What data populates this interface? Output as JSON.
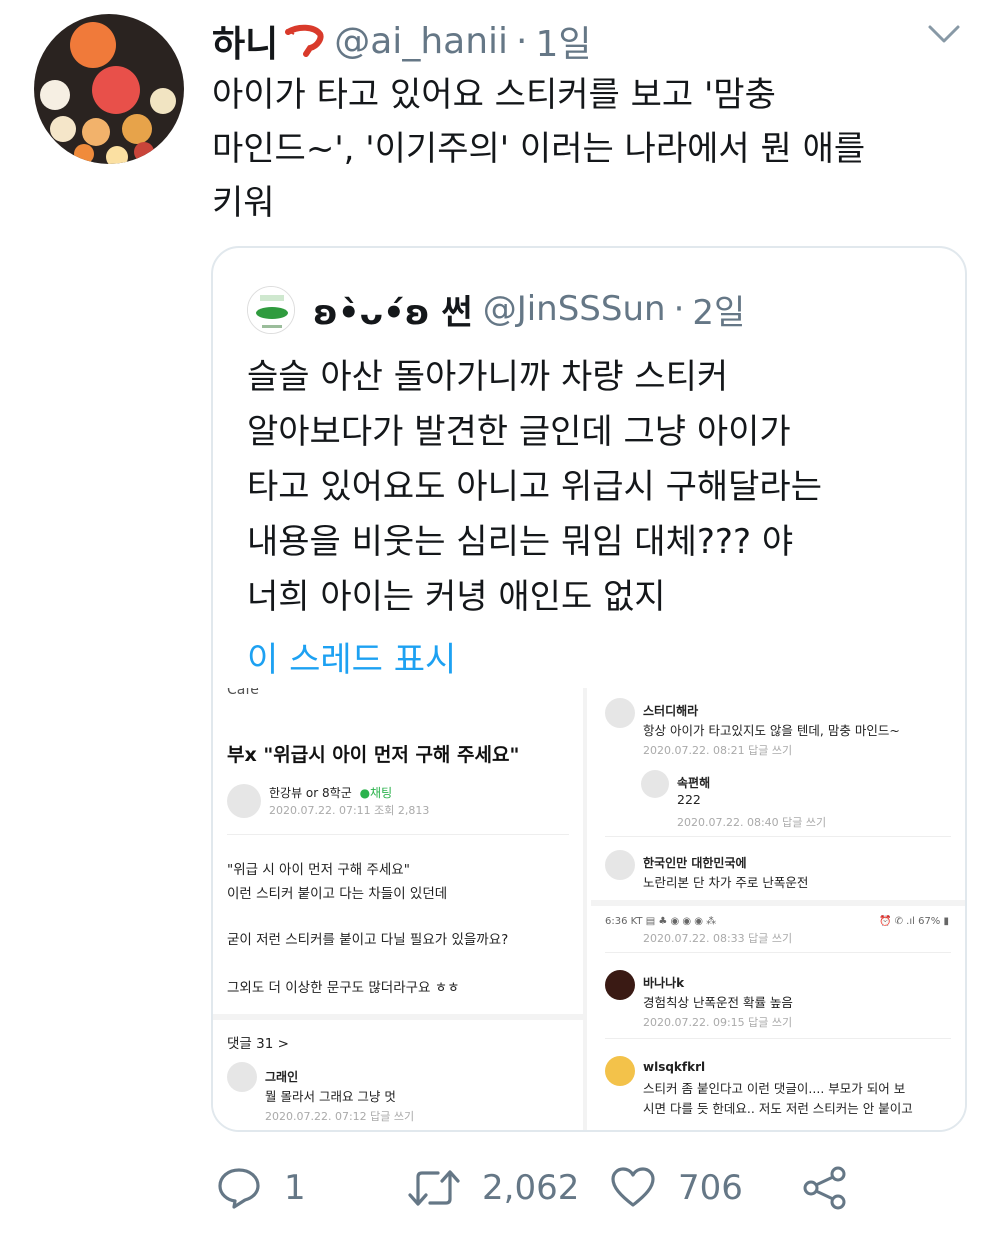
{
  "tweet": {
    "author_name": "하니",
    "author_handle": "@ai_hanii",
    "time_sep": "·",
    "time": "1일",
    "text_lines": [
      "아이가 타고 있어요 스티커를 보고 '맘충",
      "마인드~', '이기주의' 이러는 나라에서 뭔 애를",
      "키워"
    ]
  },
  "quote": {
    "author_name": "ʚ•̀ᴗ•́ʚ 썬",
    "author_handle": "@JinSSSun",
    "time_sep": "·",
    "time": "2일",
    "text_lines": [
      "슬슬 아산 돌아가니까 차량 스티커",
      "알아보다가 발견한 글인데 그냥 아이가",
      "타고 있어요도 아니고 위급시 구해달라는",
      "내용을 비웃는 심리는 뭐임 대체??? 야",
      "너희 아이는 커녕 애인도 없지"
    ],
    "show_thread": "이 스레드 표시"
  },
  "shot_left": {
    "top_crop": "Cafe",
    "post_title": "부x \"위급시 아이 먼저 구해 주세요\"",
    "author": "한강뷰 or 8학군",
    "author_badge": "●채팅",
    "date": "2020.07.22. 07:11  조회 2,813",
    "body_lines": [
      "\"위급 시 아이 먼저 구해 주세요\"",
      "이런 스티커 붙이고 다는 차들이 있던데",
      "",
      "굳이 저런 스티커를 붙이고 다닐 필요가 있을까요?",
      "",
      "그외도 더 이상한 문구도 많더라구요 ㅎㅎ"
    ],
    "comments_label": "댓글 31 >",
    "comment": {
      "name": "그래인",
      "text": "뭘 몰라서 그래요 그냥 멋",
      "date": "2020.07.22. 07:12  답글 쓰기"
    }
  },
  "shot_right": {
    "comments": [
      {
        "name": "스터디해라",
        "text": "항상 아이가 타고있지도 않을 텐데, 맘충 마인드~",
        "date": "2020.07.22. 08:21   답글 쓰기"
      },
      {
        "name": "속편해",
        "text": "222",
        "date": "2020.07.22. 08:40   답글 쓰기"
      },
      {
        "name": "한국인만 대한민국에",
        "text": "노란리본 단 차가 주로 난폭운전",
        "date": "2020.07.22. 08:33   답글 쓰기"
      },
      {
        "name": "바나나k",
        "text": "경험칙상 난폭운전 확률 높음",
        "date": "2020.07.22. 09:15   답글 쓰기"
      },
      {
        "name": "wlsqkfkrl",
        "text": "스티커 좀 붙인다고 이런 댓글이.... 부모가 되어 보",
        "text2": "시면 다를 듯 한데요.. 저도 저런 스티커는 안 붙이고"
      }
    ],
    "status_left": "6:36 KT ▤ ♣ ◉ ◉ ◉ ⁂",
    "status_right": "⏰ ✆ .ıl 67% ▮"
  },
  "actions": {
    "replies": "1",
    "retweets": "2,062",
    "likes": "706"
  }
}
